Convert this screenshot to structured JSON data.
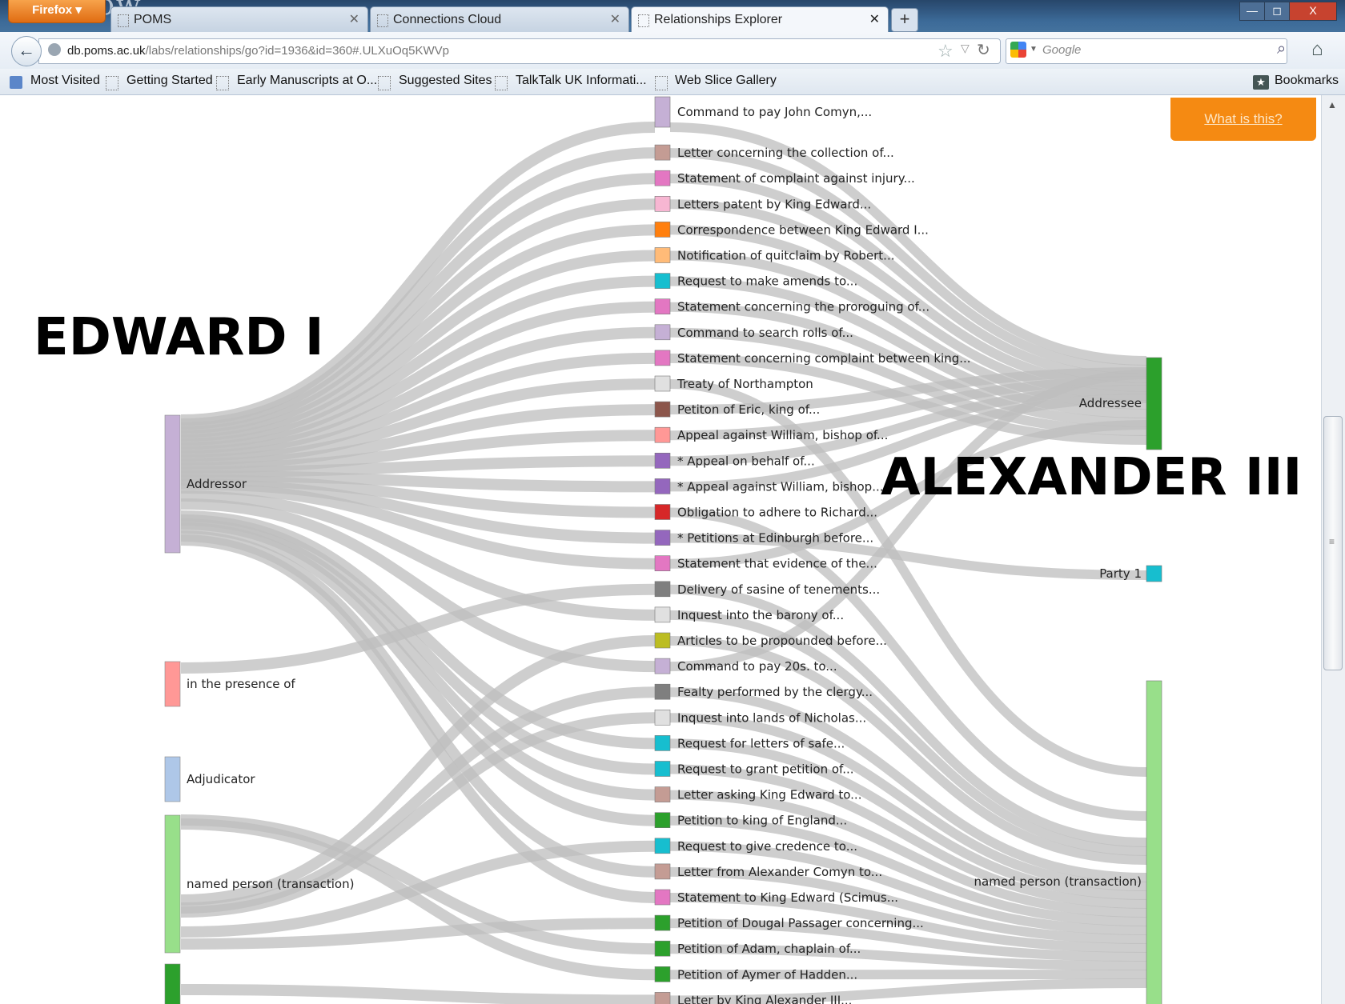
{
  "window": {
    "firefox_button": "Firefox ▾",
    "logo_text": "Glasgow",
    "tabs": [
      {
        "label": "POMS",
        "active": false
      },
      {
        "label": "Connections Cloud",
        "active": false
      },
      {
        "label": "Relationships Explorer",
        "active": true
      }
    ],
    "new_tab": "+",
    "controls": {
      "minimize": "—",
      "maximize": "◻",
      "close": "X"
    }
  },
  "navbar": {
    "url_domain": "db.poms.ac.uk",
    "url_path": "/labs/relationships/go?id=1936&id=360#.ULXuOq5KWVp",
    "url_prefix": "",
    "search_placeholder": "Google"
  },
  "bookmarks": {
    "items": [
      "Most Visited",
      "Getting Started",
      "Early Manuscripts at O...",
      "Suggested Sites",
      "TalkTalk UK Informati...",
      "Web Slice Gallery"
    ],
    "bookmarks_label": "Bookmarks"
  },
  "page": {
    "what_is_this": "What is this?",
    "edward_label": "EDWARD I",
    "alexander_label": "ALEXANDER III"
  },
  "sankey": {
    "left_nodes": [
      {
        "label": "Addressor",
        "color": "#c5b0d5"
      },
      {
        "label": "in the presence of",
        "color": "#ff9896"
      },
      {
        "label": "Adjudicator",
        "color": "#aec7e8"
      },
      {
        "label": "named person (transaction)",
        "color": "#98df8a"
      },
      {
        "label": "",
        "color": "#2ca02c"
      }
    ],
    "middle_nodes": [
      {
        "label": "Command to pay John Comyn,...",
        "color": "#c5b0d5"
      },
      {
        "label": "Letter concerning the collection of...",
        "color": "#c49c94"
      },
      {
        "label": "Statement of complaint against injury...",
        "color": "#e377c2"
      },
      {
        "label": "Letters patent by King Edward...",
        "color": "#f7b6d2"
      },
      {
        "label": "Correspondence between King Edward I...",
        "color": "#ff7f0e"
      },
      {
        "label": "Notification of quitclaim by Robert...",
        "color": "#ffbb78"
      },
      {
        "label": "Request to make amends to...",
        "color": "#17becf"
      },
      {
        "label": "Statement concerning the proroguing of...",
        "color": "#e377c2"
      },
      {
        "label": "Command to search rolls of...",
        "color": "#c5b0d5"
      },
      {
        "label": "Statement concerning complaint between king...",
        "color": "#e377c2"
      },
      {
        "label": "Treaty of Northampton",
        "color": "#e0e0e0"
      },
      {
        "label": "Petiton of Eric, king of...",
        "color": "#8c564b"
      },
      {
        "label": "Appeal against William, bishop of...",
        "color": "#ff9896"
      },
      {
        "label": "* Appeal on behalf of...",
        "color": "#9467bd"
      },
      {
        "label": "* Appeal against William, bishop...",
        "color": "#9467bd"
      },
      {
        "label": "Obligation to adhere to Richard...",
        "color": "#d62728"
      },
      {
        "label": "* Petitions at Edinburgh before...",
        "color": "#9467bd"
      },
      {
        "label": "Statement that evidence of the...",
        "color": "#e377c2"
      },
      {
        "label": "Delivery of sasine of tenements...",
        "color": "#7f7f7f"
      },
      {
        "label": "Inquest into the barony of...",
        "color": "#e0e0e0"
      },
      {
        "label": "Articles to be propounded before...",
        "color": "#bcbd22"
      },
      {
        "label": "Command to pay 20s. to...",
        "color": "#c5b0d5"
      },
      {
        "label": "Fealty performed by the clergy...",
        "color": "#7f7f7f"
      },
      {
        "label": "Inquest into lands of Nicholas...",
        "color": "#e0e0e0"
      },
      {
        "label": "Request for letters of safe...",
        "color": "#17becf"
      },
      {
        "label": "Request to grant petition of...",
        "color": "#17becf"
      },
      {
        "label": "Letter asking King Edward to...",
        "color": "#c49c94"
      },
      {
        "label": "Petition to king of England...",
        "color": "#2ca02c"
      },
      {
        "label": "Request to give credence to...",
        "color": "#17becf"
      },
      {
        "label": "Letter from Alexander Comyn to...",
        "color": "#c49c94"
      },
      {
        "label": "Statement to King Edward (Scimus...",
        "color": "#e377c2"
      },
      {
        "label": "Petition of Dougal Passager concerning...",
        "color": "#2ca02c"
      },
      {
        "label": "Petition of Adam, chaplain of...",
        "color": "#2ca02c"
      },
      {
        "label": "Petition of Aymer of Hadden...",
        "color": "#2ca02c"
      },
      {
        "label": "Letter by King Alexander III...",
        "color": "#c49c94"
      }
    ],
    "right_nodes": [
      {
        "label": "Addressee",
        "color": "#2ca02c"
      },
      {
        "label": "Party 1",
        "color": "#17becf"
      },
      {
        "label": "named person (transaction)",
        "color": "#98df8a"
      }
    ]
  }
}
